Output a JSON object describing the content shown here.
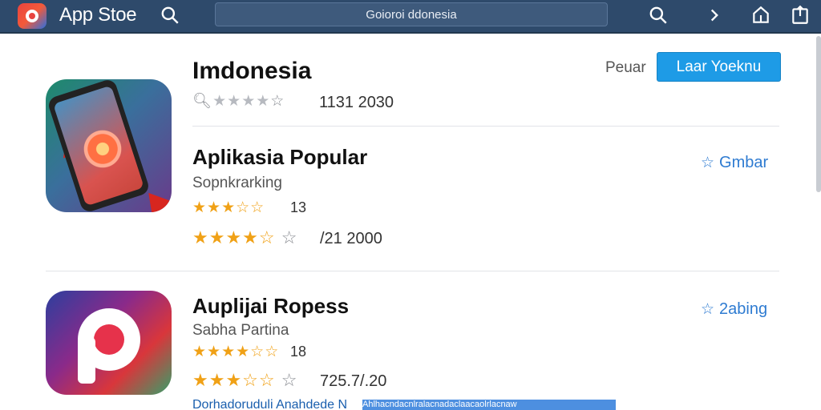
{
  "header": {
    "app_title": "App Stoe",
    "search_value": "Goioroi ddonesia"
  },
  "section": {
    "title": "Imdonesia",
    "rating_count": "1131 2030",
    "filter_label": "Peuar",
    "install_button": "Laar Yoeknu"
  },
  "apps": [
    {
      "name": "Aplikasia Popular",
      "developer": "Sopnkrarking",
      "small_count": "13",
      "rating_count": "/21 2000",
      "action": "Gmbar"
    },
    {
      "name": "Auplijai Ropess",
      "developer": "Sabha Partina",
      "small_count": "18",
      "rating_count": "725.7/.20",
      "action": "2abing"
    }
  ],
  "footer": {
    "link_text": "Dorhadoruduli Anahdede N",
    "highlight_text": "Ahlhacndacnlralacnadaclaacaolrlacnaw"
  },
  "colors": {
    "topbar": "#2e4a6b",
    "accent": "#1e9be6",
    "star": "#f0a116",
    "link": "#2e7bd1"
  },
  "icons": {
    "header": [
      "app-logo",
      "search-icon",
      "search-icon",
      "chevron-right-icon",
      "bookmark-icon",
      "share-icon"
    ],
    "rating": "star-icon",
    "action": "star-outline-icon"
  },
  "ratings": {
    "section": 0,
    "app_1_primary": 3.5,
    "app_1_secondary": 4.5,
    "app_2_primary": 4.5,
    "app_2_secondary": 3.5
  }
}
